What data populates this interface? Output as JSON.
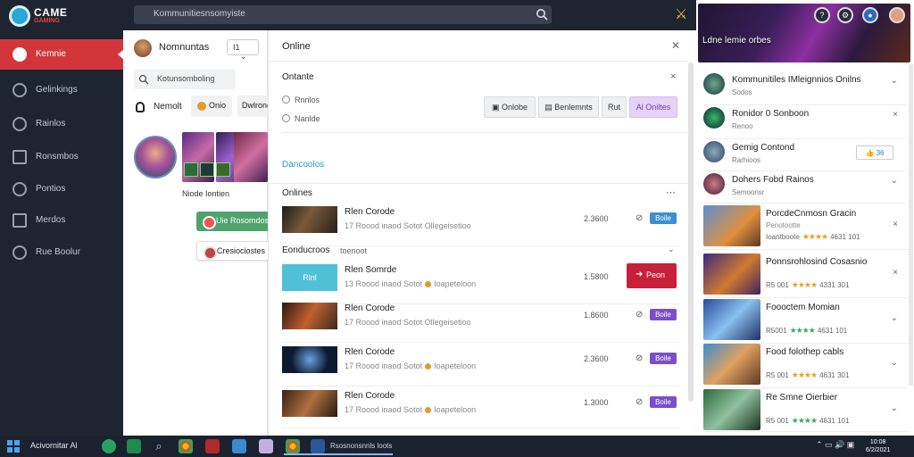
{
  "app": {
    "brand_top": "CAME",
    "brand_bottom": "GAMING"
  },
  "search": {
    "value": "Kommunitiesnsomyiste"
  },
  "sidebar": {
    "items": [
      {
        "label": "Kemnie",
        "icon": "user-icon",
        "active": true
      },
      {
        "label": "Gelinkings",
        "icon": "settings-icon"
      },
      {
        "label": "Rainlos",
        "icon": "people-icon"
      },
      {
        "label": "Ronsmbos",
        "icon": "folder-icon"
      },
      {
        "label": "Pontios",
        "icon": "clock-icon"
      },
      {
        "label": "Merdos",
        "icon": "grid-icon"
      },
      {
        "label": "Rue Boolur",
        "icon": "globe-icon"
      }
    ]
  },
  "profile": {
    "title": "Nomnuntas",
    "badge": "I1",
    "search_value": "Kotunsomboling",
    "name": "Nemolt",
    "chip1": "Onio",
    "chip2": "Dwlrono",
    "caption": "Niode Iontien",
    "button_green": "Uie Rosomdos",
    "button_white": "Cresiociostes"
  },
  "main": {
    "title": "Online",
    "subtitle": "Ontante",
    "radios": [
      "Rnnlos",
      "Nanlde"
    ],
    "filters": [
      "Onlobe",
      "Benlemnts",
      "Rut",
      "Al Oniltes"
    ],
    "section_title": "Dancoolos",
    "online_heading": "Onlines",
    "group_heading": "Eonducroos",
    "group_sub": "toenoot",
    "rows": [
      {
        "title": "Rlen Corode",
        "sub": "17 Roood inaod Sotot",
        "sub2": "Ollegeisetioo",
        "num": "2.3600",
        "tag": "Boile",
        "tag_color": "#3d8fd1"
      },
      {
        "title": "Rlen Somrde",
        "sub": "13 Roood inaod Sotot",
        "sub2": "Ioapeteloon",
        "num": "1.5800",
        "button": "Peon"
      },
      {
        "title": "Rlen Corode",
        "sub": "17 Roood inaod Sotot",
        "sub2": "Ollegeisetioo",
        "num": "1.8600",
        "tag": "Boile",
        "tag_color": "#7b4fc9"
      },
      {
        "title": "Rlen Corode",
        "sub": "17 Roood inaod Sotot",
        "sub2": "Ioapeteloon",
        "num": "2.3600",
        "tag": "Boile",
        "tag_color": "#7b4fc9"
      },
      {
        "title": "Rlen Corode",
        "sub": "17 Roood inaod Sotot",
        "sub2": "Ioapeteloon",
        "num": "1.3000",
        "tag": "Boile",
        "tag_color": "#7b4fc9"
      }
    ],
    "first_row_thumb_label": "Rlnl"
  },
  "right": {
    "banner_title": "Ldne lemie orbes",
    "people": [
      {
        "title": "Kommunitiles IMleignnios Onilns",
        "sub": "Sodos"
      },
      {
        "title": "Ronidor 0 Sonboon",
        "sub": "Renoo"
      },
      {
        "title": "Gemig Contond",
        "sub": "Rarhioos",
        "tag": "36"
      },
      {
        "title": "Dohers Fobd Rainos",
        "sub": "Semoonsr"
      }
    ],
    "games": [
      {
        "title": "PorcdeCnmosn Gracin",
        "sub": "Penotootte",
        "rating": "Ioantboote",
        "score": "4631 101",
        "stars": "★★★★",
        "green": false
      },
      {
        "title": "Ponnsrohlosind Cosasnio",
        "sub": "",
        "rating": "R5 001",
        "score": "4331 301",
        "stars": "★★★★",
        "green": false
      },
      {
        "title": "Foooctem Momian",
        "sub": "",
        "rating": "R5001",
        "score": "4631 101",
        "stars": "★★★★",
        "green": true
      },
      {
        "title": "Food folothep cabls",
        "sub": "",
        "rating": "R5 001",
        "score": "4631 301",
        "stars": "★★★★",
        "green": false
      },
      {
        "title": "Re Smne Oierbier",
        "sub": "",
        "rating": "R5 001",
        "score": "4631 101",
        "stars": "★★★★",
        "green": true
      }
    ]
  },
  "taskbar": {
    "label": "Acivornitar Al",
    "task": "Rsosnonsnnls loots",
    "time1": "10:08",
    "time2": "6/2/2021"
  }
}
